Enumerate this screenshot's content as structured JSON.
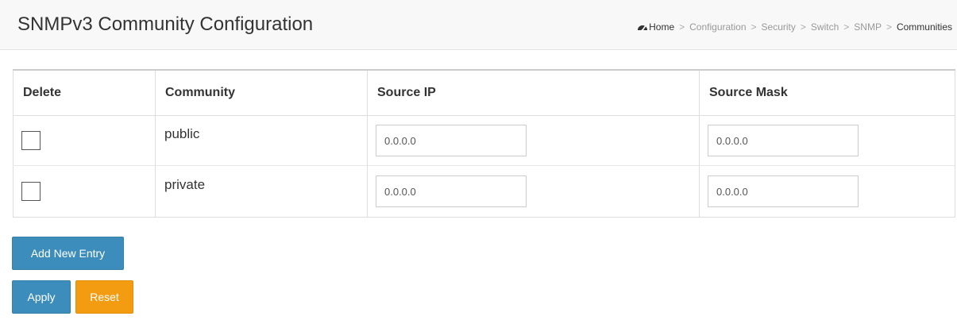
{
  "header": {
    "title": "SNMPv3 Community Configuration",
    "breadcrumb": [
      "Home",
      "Configuration",
      "Security",
      "Switch",
      "SNMP",
      "Communities"
    ],
    "breadcrumb_separator": ">",
    "home_icon": "dashboard-icon"
  },
  "table": {
    "columns": [
      "Delete",
      "Community",
      "Source IP",
      "Source Mask"
    ],
    "rows": [
      {
        "delete": false,
        "community": "public",
        "source_ip": "0.0.0.0",
        "source_mask": "0.0.0.0"
      },
      {
        "delete": false,
        "community": "private",
        "source_ip": "0.0.0.0",
        "source_mask": "0.0.0.0"
      }
    ]
  },
  "buttons": {
    "add_new_entry": "Add New Entry",
    "apply": "Apply",
    "reset": "Reset"
  },
  "colors": {
    "primary": "#3c8dbc",
    "warning": "#f39c12",
    "header_bg": "#f8f8f8"
  }
}
